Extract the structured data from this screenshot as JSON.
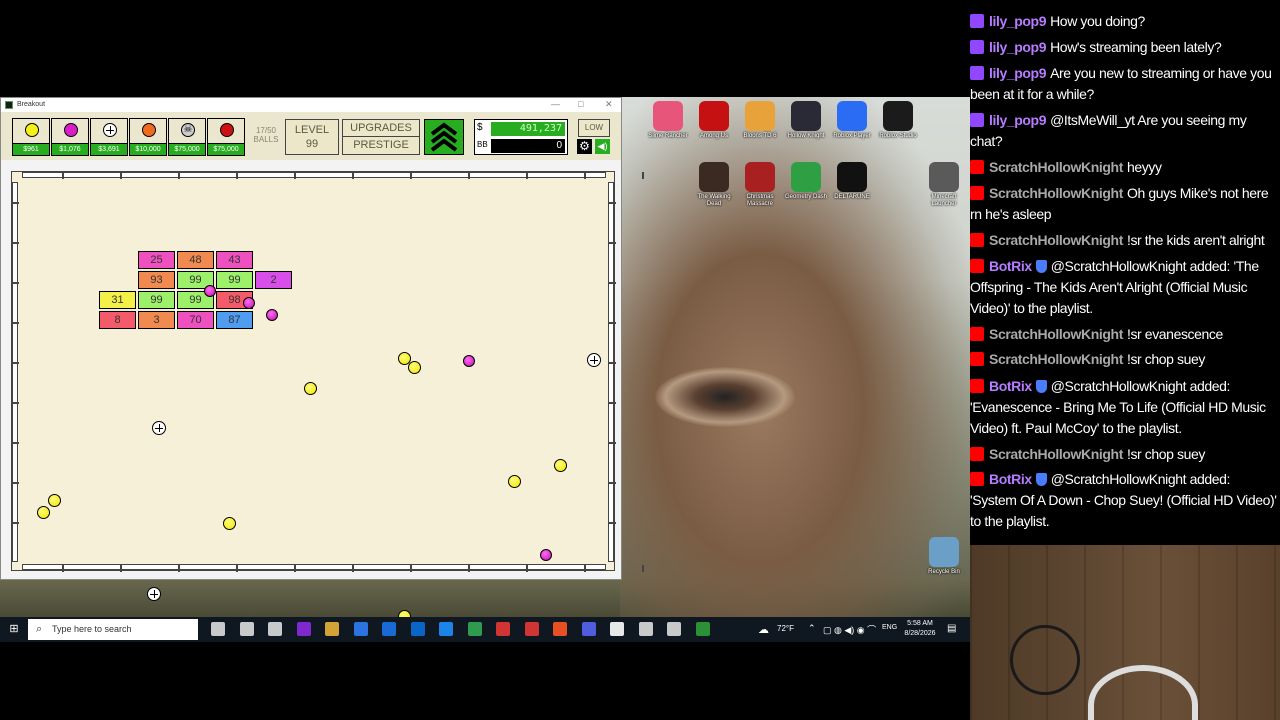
{
  "window": {
    "title": "Breakout",
    "controls": [
      "—",
      "□",
      "✕"
    ]
  },
  "hud": {
    "shop": [
      {
        "name": "basic",
        "color": "#f5f01a",
        "price": "$961",
        "icon": "yellow-ball-icon"
      },
      {
        "name": "plasma",
        "color": "#d91ec8",
        "price": "$1,076",
        "icon": "plasma-ball-icon"
      },
      {
        "name": "sniper",
        "color": "#ffffff",
        "price": "$3,691",
        "icon": "crosshair-ball-icon"
      },
      {
        "name": "scatter",
        "color": "#ee6b1f",
        "price": "$10,000",
        "icon": "orange-ball-icon"
      },
      {
        "name": "cannonball",
        "color": "#cccccc",
        "price": "$75,000",
        "icon": "skull-ball-icon"
      },
      {
        "name": "poison",
        "color": "#cc1111",
        "price": "$75,000",
        "icon": "red-ball-icon"
      }
    ],
    "balls_count": "17/50",
    "balls_label": "BALLS",
    "level_label": "LEVEL",
    "level_value": "99",
    "upgrades_label": "UPGRADES",
    "prestige_label": "PRESTIGE",
    "money_symbol": "$",
    "money_value": "491,237",
    "bb_symbol": "BB",
    "bb_value": "0",
    "low_label": "LOW"
  },
  "bricks": [
    {
      "row": 0,
      "col": 1,
      "value": "25",
      "color": "#ee50c0"
    },
    {
      "row": 0,
      "col": 2,
      "value": "48",
      "color": "#f18a50"
    },
    {
      "row": 0,
      "col": 3,
      "value": "43",
      "color": "#ee50c0"
    },
    {
      "row": 1,
      "col": 1,
      "value": "93",
      "color": "#f18a50"
    },
    {
      "row": 1,
      "col": 2,
      "value": "99",
      "color": "#9cf06a"
    },
    {
      "row": 1,
      "col": 3,
      "value": "99",
      "color": "#9cf06a"
    },
    {
      "row": 1,
      "col": 4,
      "value": "2",
      "color": "#d74fe8"
    },
    {
      "row": 2,
      "col": 0,
      "value": "31",
      "color": "#f4f04a"
    },
    {
      "row": 2,
      "col": 1,
      "value": "99",
      "color": "#9cf06a"
    },
    {
      "row": 2,
      "col": 2,
      "value": "99",
      "color": "#9cf06a"
    },
    {
      "row": 2,
      "col": 3,
      "value": "98",
      "color": "#f45b6a"
    },
    {
      "row": 3,
      "col": 0,
      "value": "8",
      "color": "#f45b6a"
    },
    {
      "row": 3,
      "col": 1,
      "value": "3",
      "color": "#f18a50"
    },
    {
      "row": 3,
      "col": 2,
      "value": "70",
      "color": "#ee50c0"
    },
    {
      "row": 3,
      "col": 3,
      "value": "87",
      "color": "#4f9cf0"
    }
  ],
  "desktop_icons": [
    {
      "label": "Slime Rancher",
      "color": "#e8557a"
    },
    {
      "label": "Among Us",
      "color": "#c51111"
    },
    {
      "label": "Bloons TD 6",
      "color": "#e8a23a"
    },
    {
      "label": "Hollow Knight",
      "color": "#2a2a36"
    },
    {
      "label": "Roblox Player",
      "color": "#2a6df4"
    },
    {
      "label": "Roblox Studio",
      "color": "#1b1b1b"
    },
    {
      "label": "The Walking Dead",
      "color": "#3b2a22"
    },
    {
      "label": "Christmas Massacre",
      "color": "#a82020"
    },
    {
      "label": "Geometry Dash",
      "color": "#2ea043"
    },
    {
      "label": "DELTARUNE",
      "color": "#111111"
    },
    {
      "label": "Minecraft Launcher",
      "color": "#5a5a5a"
    },
    {
      "label": "Recycle Bin",
      "color": "#6aa0c8"
    }
  ],
  "taskbar": {
    "search_placeholder": "Type here to search",
    "weather": "72°F",
    "language": "ENG",
    "time": "5:58 AM",
    "date": "8/28/2026"
  },
  "chat": [
    {
      "platform": "twitch",
      "user": "lily_pop9",
      "user_color": "#b57cff",
      "text": "How you doing?"
    },
    {
      "platform": "twitch",
      "user": "lily_pop9",
      "user_color": "#b57cff",
      "text": "How's streaming been lately?"
    },
    {
      "platform": "twitch",
      "user": "lily_pop9",
      "user_color": "#b57cff",
      "text": "Are you new to streaming or have you been at it for a while?"
    },
    {
      "platform": "twitch",
      "user": "lily_pop9",
      "user_color": "#b57cff",
      "text": "@ItsMeWill_yt Are you seeing my chat?"
    },
    {
      "platform": "youtube",
      "user": "ScratchHollowKnight",
      "user_color": "#a8a8a8",
      "text": "heyyy"
    },
    {
      "platform": "youtube",
      "user": "ScratchHollowKnight",
      "user_color": "#a8a8a8",
      "text": "Oh guys Mike's not here rn he's asleep"
    },
    {
      "platform": "youtube",
      "user": "ScratchHollowKnight",
      "user_color": "#a8a8a8",
      "text": "!sr the kids aren't alright"
    },
    {
      "platform": "youtube",
      "user": "BotRix",
      "user_color": "#b57cff",
      "bot": true,
      "text": "@ScratchHollowKnight added: 'The Offspring - The Kids Aren't Alright (Official Music Video)' to the playlist."
    },
    {
      "platform": "youtube",
      "user": "ScratchHollowKnight",
      "user_color": "#a8a8a8",
      "text": "!sr evanescence"
    },
    {
      "platform": "youtube",
      "user": "ScratchHollowKnight",
      "user_color": "#a8a8a8",
      "text": "!sr chop suey"
    },
    {
      "platform": "youtube",
      "user": "BotRix",
      "user_color": "#b57cff",
      "bot": true,
      "text": "@ScratchHollowKnight added: 'Evanescence - Bring Me To Life (Official HD Music Video) ft. Paul McCoy' to the playlist."
    },
    {
      "platform": "youtube",
      "user": "ScratchHollowKnight",
      "user_color": "#a8a8a8",
      "text": "!sr chop suey"
    },
    {
      "platform": "youtube",
      "user": "BotRix",
      "user_color": "#b57cff",
      "bot": true,
      "text": "@ScratchHollowKnight added: 'System Of A Down - Chop Suey! (Official HD Video)' to the playlist."
    }
  ],
  "colors": {
    "field_bg": "#f6f0d8",
    "accent_green": "#27ad1f",
    "twitch": "#9146ff",
    "youtube": "#ff0000"
  }
}
